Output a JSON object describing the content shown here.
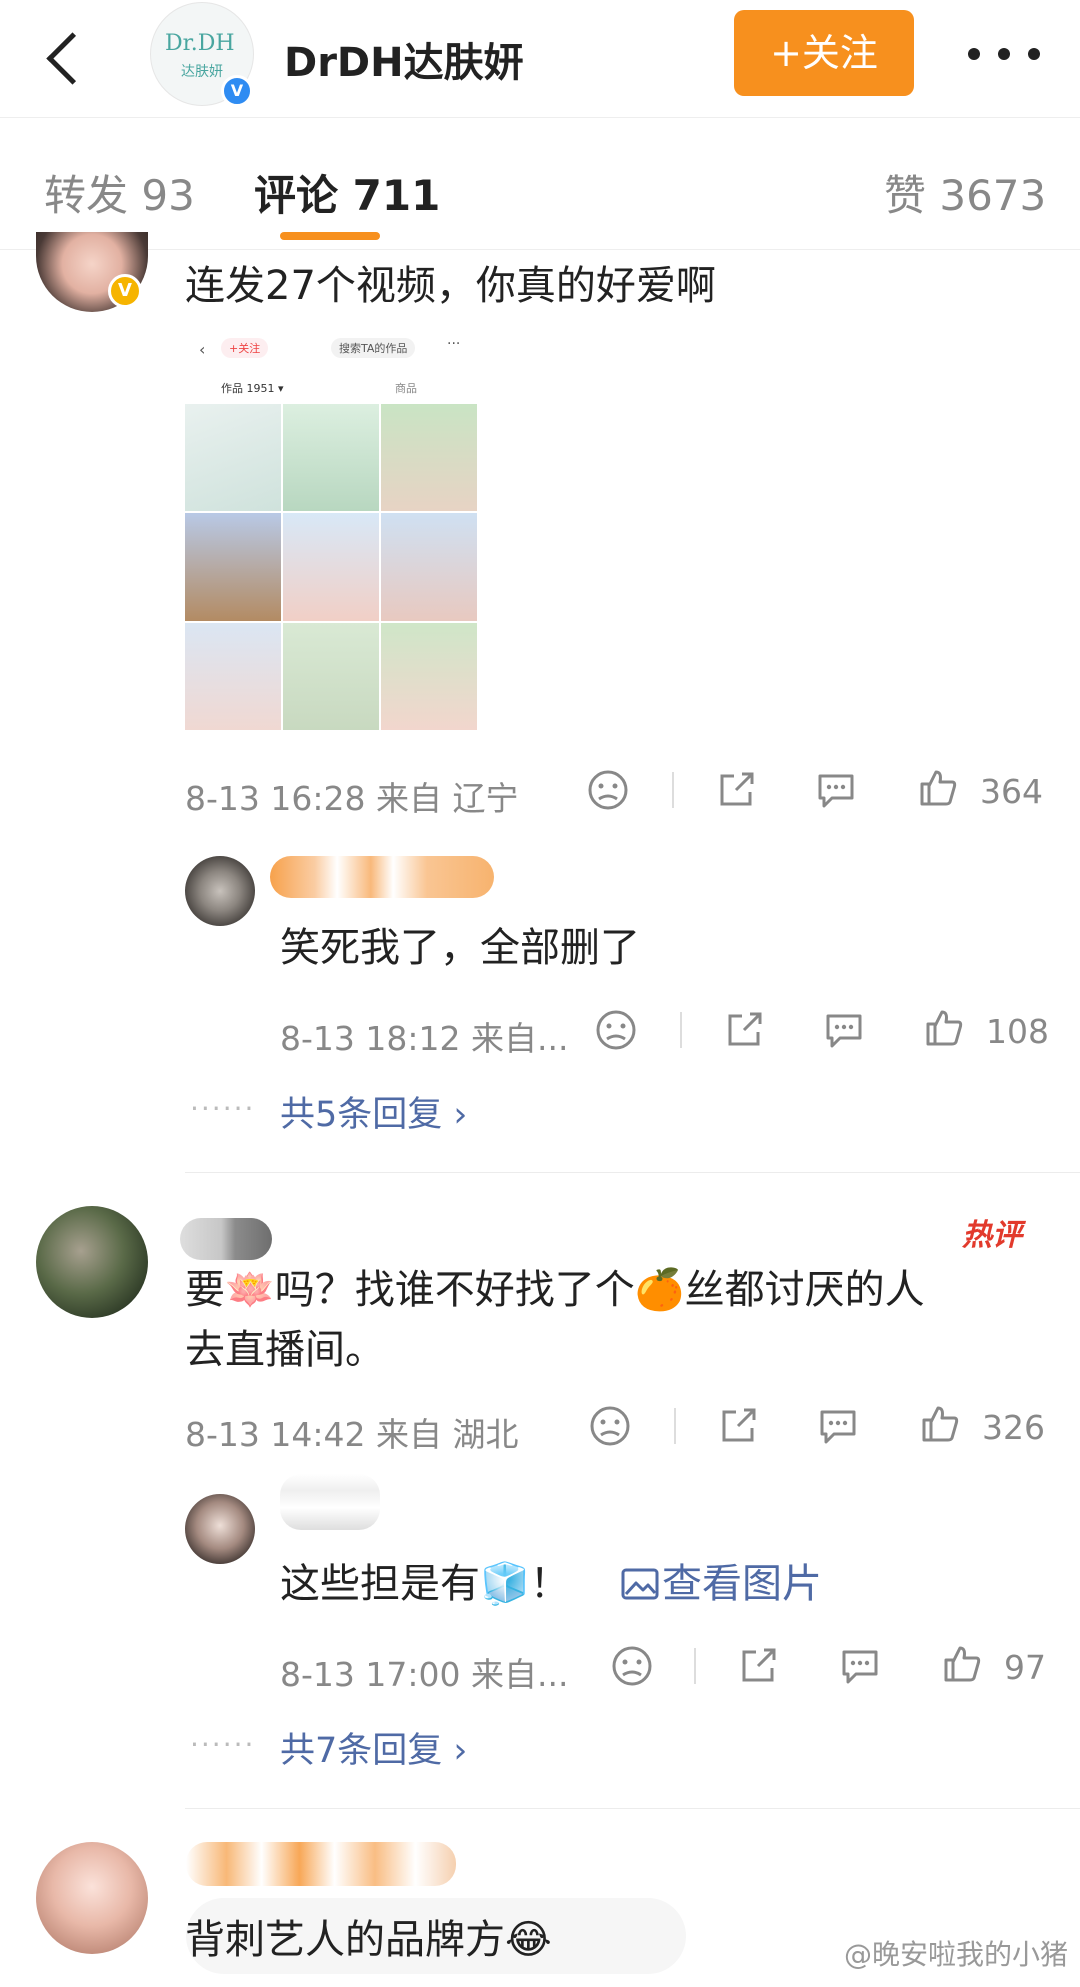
{
  "header": {
    "account_name": "DrDH达肤妍",
    "logo_line1": "Dr.DH",
    "logo_line2": "达肤妍",
    "follow_label": "+关注",
    "verified_mark": "V"
  },
  "tabs": {
    "repost": "转发 93",
    "comments": "评论 711",
    "likes": "赞 3673"
  },
  "comments": [
    {
      "text": "连发27个视频，你真的好爱啊",
      "time": "8-13 16:28",
      "location": "来自 辽宁",
      "likes": "364",
      "screenshot": {
        "follow": "+关注",
        "search": "搜索TA的作品",
        "tab_works": "作品 1951 ▾",
        "tab_shop": "商品"
      },
      "reply": {
        "text": "笑死我了，全部删了",
        "time": "8-13 18:12",
        "location": "来自...",
        "likes": "108"
      },
      "more_replies": "共5条回复 ›"
    },
    {
      "hot_label": "热评",
      "text_line1": "要🪷吗？找谁不好找了个🍊丝都讨厌的人",
      "text_line2": "去直播间。",
      "time": "8-13 14:42",
      "location": "来自 湖北",
      "likes": "326",
      "reply": {
        "text": "这些担是有🧊！",
        "image_link": "查看图片",
        "time": "8-13 17:00",
        "location": "来自...",
        "likes": "97"
      },
      "more_replies": "共7条回复 ›"
    },
    {
      "text": "背刺艺人的品牌方😂"
    }
  ],
  "dots": "······",
  "watermark": "@晚安啦我的小猪",
  "colors": {
    "accent": "#f7901e",
    "link": "#4f6aa5",
    "hot": "#e23a2c"
  }
}
